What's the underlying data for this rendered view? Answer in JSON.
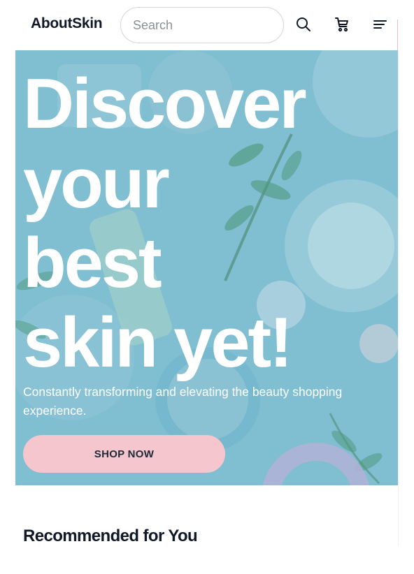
{
  "header": {
    "logo": "AboutSkin",
    "search_placeholder": "Search",
    "icons": [
      "search-icon",
      "cart-icon",
      "menu-icon"
    ]
  },
  "hero": {
    "title_lines": [
      "Discover",
      "your",
      "best",
      "skin yet!"
    ],
    "subtitle": "Constantly transforming and elevating the beauty shopping experience.",
    "cta_label": "SHOP NOW"
  },
  "section": {
    "title": "Recommended for You"
  },
  "colors": {
    "hero_overlay": "#80bed2",
    "cta_background": "#f5c6cd",
    "text_dark": "#111827"
  }
}
